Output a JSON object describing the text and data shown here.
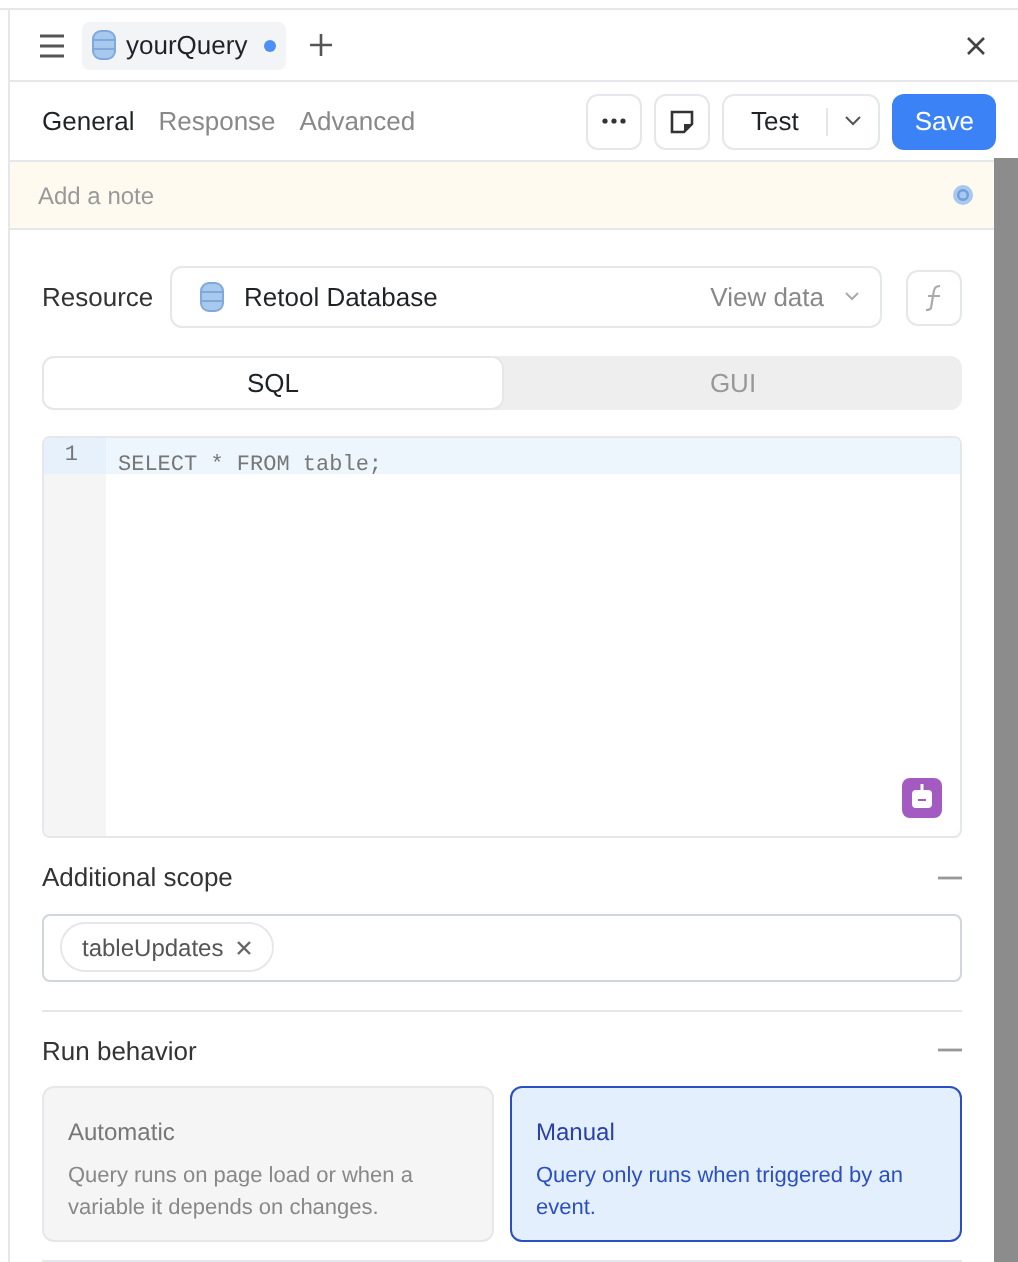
{
  "tab": {
    "title": "yourQuery",
    "unsaved": true
  },
  "subtabs": [
    {
      "label": "General",
      "selected": true
    },
    {
      "label": "Response",
      "selected": false
    },
    {
      "label": "Advanced",
      "selected": false
    }
  ],
  "toolbar": {
    "run_label": "Test",
    "save_label": "Save"
  },
  "note": {
    "placeholder": "Add a note"
  },
  "resource": {
    "label": "Resource",
    "value": "Retool Database",
    "link": "View data"
  },
  "mode_tabs": [
    {
      "label": "SQL",
      "selected": true
    },
    {
      "label": "GUI",
      "selected": false
    }
  ],
  "editor": {
    "lines": [
      {
        "number": "1",
        "code": "SELECT * FROM table;",
        "active": true
      }
    ]
  },
  "additional_scope": {
    "title": "Additional scope",
    "expanded": true,
    "tags": [
      "tableUpdates"
    ]
  },
  "run_behavior": {
    "title": "Run behavior",
    "expanded": true,
    "options": [
      {
        "title": "Automatic",
        "description": "Query runs on page load or when a variable it depends on changes.",
        "selected": false
      },
      {
        "title": "Manual",
        "description": "Query only runs when triggered by an event.",
        "selected": true
      }
    ]
  }
}
